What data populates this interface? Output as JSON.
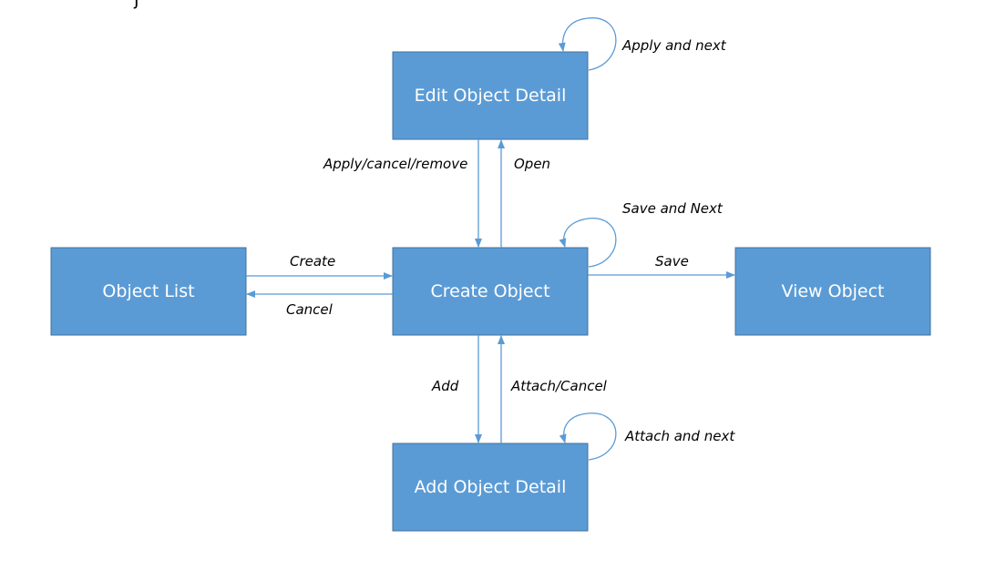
{
  "diagram": {
    "title_fragment": "j",
    "colors": {
      "node_fill": "#5B9BD5",
      "node_border": "#41719C",
      "edge": "#5B9BD5",
      "node_text": "#FFFFFF",
      "edge_text": "#000000"
    },
    "nodes": {
      "edit_object_detail": {
        "label": "Edit Object Detail"
      },
      "object_list": {
        "label": "Object List"
      },
      "create_object": {
        "label": "Create Object"
      },
      "view_object": {
        "label": "View Object"
      },
      "add_object_detail": {
        "label": "Add Object Detail"
      }
    },
    "edges": {
      "apply_and_next": {
        "from": "Edit Object Detail",
        "to": "Edit Object Detail",
        "label": "Apply and next"
      },
      "apply_cancel_remove": {
        "from": "Edit Object Detail",
        "to": "Create Object",
        "label": "Apply/cancel/remove"
      },
      "open": {
        "from": "Create Object",
        "to": "Edit Object Detail",
        "label": "Open"
      },
      "save_and_next": {
        "from": "Create Object",
        "to": "Create Object",
        "label": "Save and Next"
      },
      "create": {
        "from": "Object List",
        "to": "Create Object",
        "label": "Create"
      },
      "cancel": {
        "from": "Create Object",
        "to": "Object List",
        "label": "Cancel"
      },
      "save": {
        "from": "Create Object",
        "to": "View Object",
        "label": "Save"
      },
      "add": {
        "from": "Create Object",
        "to": "Add Object Detail",
        "label": "Add"
      },
      "attach_cancel": {
        "from": "Add Object Detail",
        "to": "Create Object",
        "label": "Attach/Cancel"
      },
      "attach_and_next": {
        "from": "Add Object Detail",
        "to": "Add Object Detail",
        "label": "Attach and next"
      }
    }
  }
}
